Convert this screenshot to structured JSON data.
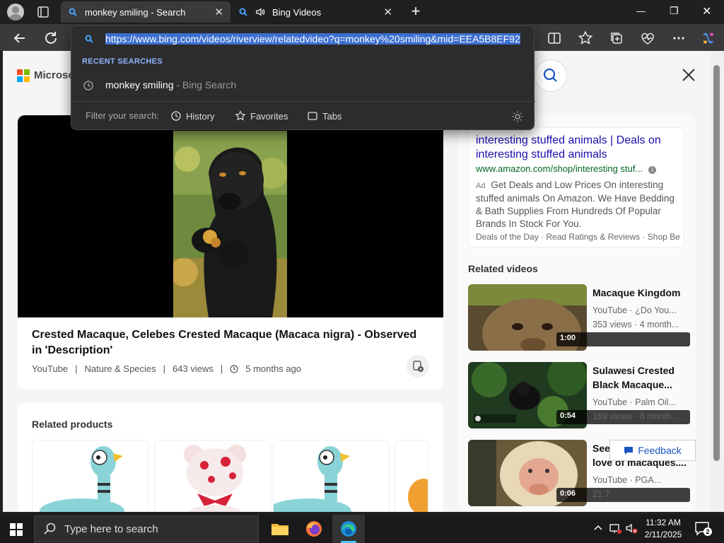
{
  "tabs": [
    {
      "label": "monkey smiling - Search",
      "close": "✕"
    },
    {
      "label": "Bing Videos",
      "close": "✕"
    }
  ],
  "new_tab": "+",
  "window_controls": {
    "minimize": "—",
    "maximize": "❐",
    "close": "✕"
  },
  "address": {
    "url": "https://www.bing.com/videos/riverview/relatedvideo?q=monkey%20smiling&mid=EEA5B8EF92"
  },
  "dropdown": {
    "recent_header": "RECENT SEARCHES",
    "recent_query": "monkey smiling",
    "recent_suffix": " - Bing Search",
    "filter_label": "Filter your search:",
    "filters": [
      "History",
      "Favorites",
      "Tabs"
    ]
  },
  "page": {
    "brand": "Microsoft",
    "video": {
      "title": "Crested Macaque, Celebes Crested Macaque (Macaca nigra) - Observed in 'Description'",
      "source": "YouTube",
      "category": "Nature & Species",
      "views": "643 views",
      "age": "5 months ago"
    },
    "related_products_title": "Related products",
    "ad": {
      "title": "interesting stuffed animals | Deals on interesting stuffed animals",
      "url": "www.amazon.com/shop/interesting stuf...",
      "badge": "Ad",
      "description": "Get Deals and Low Prices On interesting stuffed animals On Amazon. We Have Bedding & Bath Supplies From Hundreds Of Popular Brands In Stock For You.",
      "links": "Deals of the Day · Read Ratings & Reviews · Shop Be..."
    },
    "related_videos_title": "Related videos",
    "related_videos": [
      {
        "title": "Macaque Kingdom",
        "source": "YouTube · ¿Do You...",
        "stats": "353 views · 4 month...",
        "duration": "1:00"
      },
      {
        "title": "Sulawesi Crested Black Macaque...",
        "source": "YouTube · Palm Oil...",
        "stats": "169 views · 6 month...",
        "duration": "0:54"
      },
      {
        "title": "See the wonderful love of macaques....",
        "source": "YouTube · PGA...",
        "stats": "21.7",
        "duration": "0:06"
      }
    ],
    "feedback": "Feedback"
  },
  "taskbar": {
    "search_placeholder": "Type here to search",
    "time": "11:32 AM",
    "date": "2/11/2025",
    "notification_count": "2"
  }
}
